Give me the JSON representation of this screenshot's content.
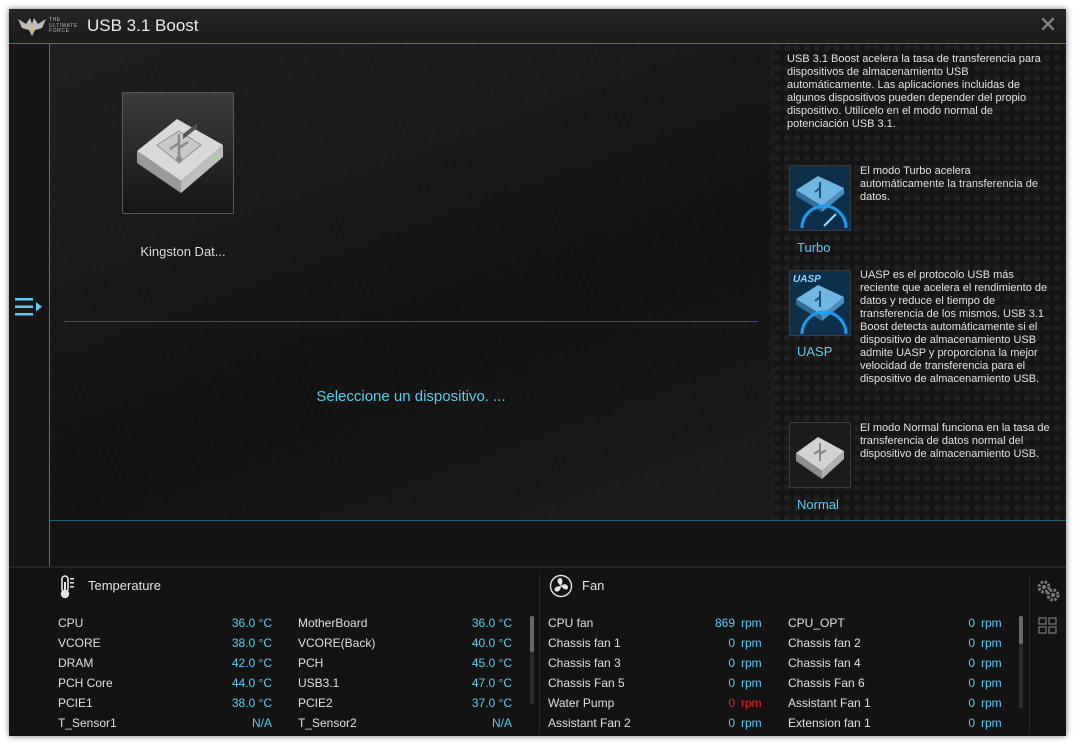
{
  "window": {
    "title": "USB 3.1 Boost",
    "logo_text": "THE ULTIMATE FORCE",
    "icons": {
      "logo": "tuf-eagle-logo-icon",
      "close": "close-icon",
      "menu": "menu-expand-icon"
    }
  },
  "main": {
    "device_name": "Kingston Dat...",
    "device_icon": "usb-drive-icon",
    "prompt": "Seleccione un dispositivo. ..."
  },
  "info": {
    "intro": "USB 3.1 Boost acelera la tasa de transferencia para dispositivos de almacenamiento USB automáticamente. Las aplicaciones incluidas de algunos dispositivos pueden depender del propio dispositivo. Utilícelo en el modo normal de potenciación USB 3.1.",
    "modes": [
      {
        "label": "Turbo",
        "icon": "turbo-mode-icon",
        "description": "El modo Turbo acelera automáticamente la transferencia de datos."
      },
      {
        "label": "UASP",
        "icon": "uasp-mode-icon",
        "badge": "UASP",
        "description": "UASP es el protocolo USB más reciente que acelera el rendimiento de datos y reduce el tiempo de transferencia de los mismos. USB 3.1 Boost detecta automáticamente si el dispositivo de almacenamiento USB admite UASP y proporciona la mejor velocidad de transferencia para el dispositivo de almacenamiento USB."
      },
      {
        "label": "Normal",
        "icon": "normal-mode-icon",
        "description": "El modo Normal funciona en la tasa de transferencia de datos normal del dispositivo de almacenamiento USB."
      }
    ]
  },
  "temperature": {
    "title": "Temperature",
    "icon": "thermometer-icon",
    "left": [
      {
        "label": "CPU",
        "value": "36.0 °C"
      },
      {
        "label": "VCORE",
        "value": "38.0 °C"
      },
      {
        "label": "DRAM",
        "value": "42.0 °C"
      },
      {
        "label": "PCH Core",
        "value": "44.0 °C"
      },
      {
        "label": "PCIE1",
        "value": "38.0 °C"
      },
      {
        "label": "T_Sensor1",
        "value": "N/A"
      }
    ],
    "right": [
      {
        "label": "MotherBoard",
        "value": "36.0 °C"
      },
      {
        "label": "VCORE(Back)",
        "value": "40.0 °C"
      },
      {
        "label": "PCH",
        "value": "45.0 °C"
      },
      {
        "label": "USB3.1",
        "value": "47.0 °C"
      },
      {
        "label": "PCIE2",
        "value": "37.0 °C"
      },
      {
        "label": "T_Sensor2",
        "value": "N/A"
      }
    ]
  },
  "fan": {
    "title": "Fan",
    "icon": "fan-icon",
    "unit": "rpm",
    "alert_color": "#e02222",
    "left": [
      {
        "label": "CPU fan",
        "value": "869"
      },
      {
        "label": "Chassis fan 1",
        "value": "0"
      },
      {
        "label": "Chassis fan 3",
        "value": "0"
      },
      {
        "label": "Chassis Fan 5",
        "value": "0"
      },
      {
        "label": "Water Pump",
        "value": "0",
        "alert": true
      },
      {
        "label": "Assistant Fan 2",
        "value": "0"
      }
    ],
    "right": [
      {
        "label": "CPU_OPT",
        "value": "0"
      },
      {
        "label": "Chassis fan 2",
        "value": "0"
      },
      {
        "label": "Chassis fan 4",
        "value": "0"
      },
      {
        "label": "Chassis Fan 6",
        "value": "0"
      },
      {
        "label": "Assistant Fan 1",
        "value": "0"
      },
      {
        "label": "Extension fan 1",
        "value": "0"
      }
    ]
  },
  "toolbar": {
    "settings_icon": "gears-icon",
    "layout_icon": "grid-layout-icon"
  },
  "colors": {
    "accent": "#5ecbf3",
    "border": "#2f7fa0",
    "background": "#141414"
  }
}
